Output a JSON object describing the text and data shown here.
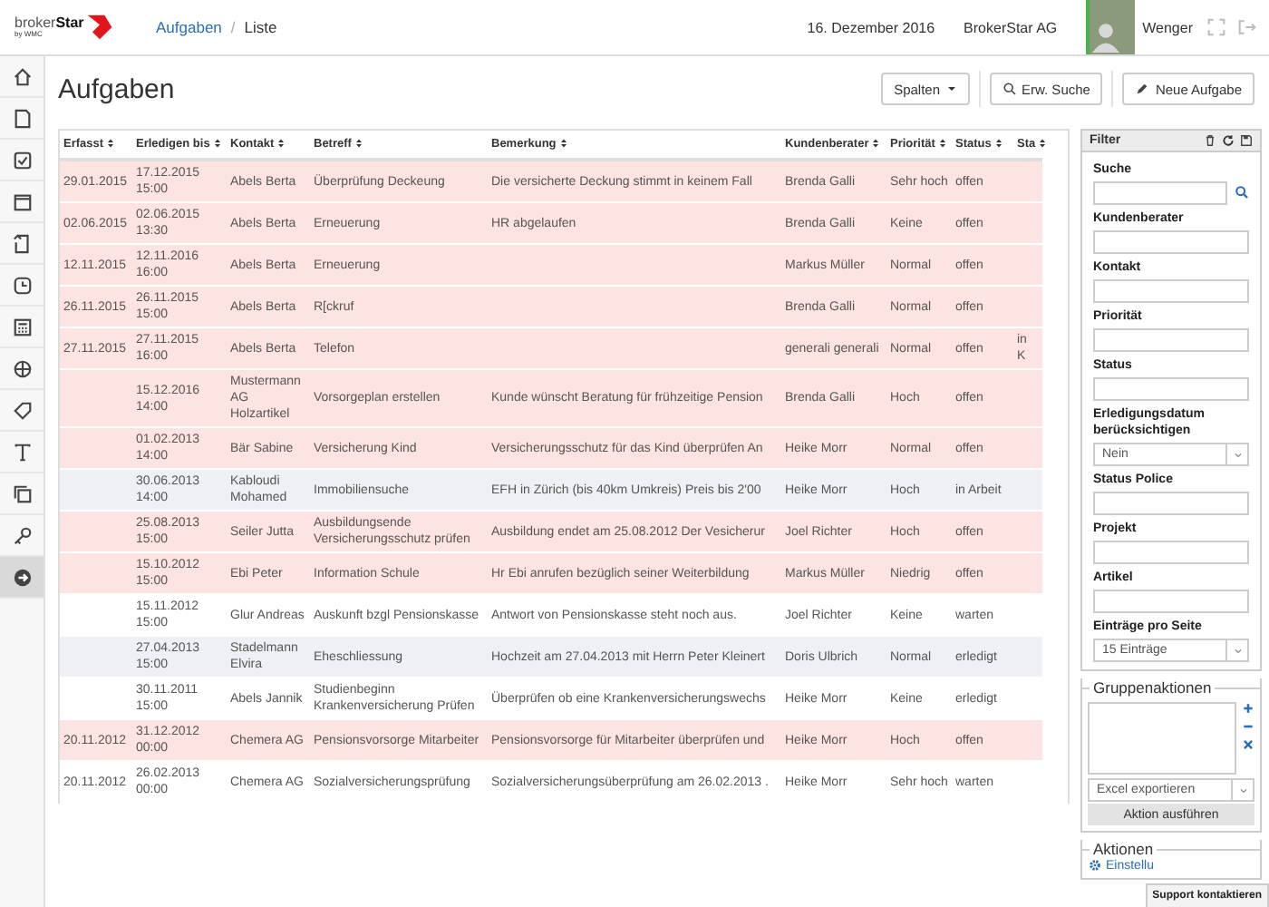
{
  "header": {
    "logo": {
      "word": "broker",
      "accent": "Star",
      "tagline": "by WMC"
    },
    "breadcrumb": {
      "items": [
        "Aufgaben",
        "Liste"
      ],
      "separator": "/"
    },
    "date": "16. Dezember 2016",
    "company": "BrokerStar AG",
    "user": "Wenger"
  },
  "sidebar": {
    "items": [
      {
        "selected": false
      },
      {
        "selected": false
      },
      {
        "selected": false
      },
      {
        "selected": false
      },
      {
        "selected": false
      },
      {
        "selected": false
      },
      {
        "selected": false
      },
      {
        "selected": false
      },
      {
        "selected": false
      },
      {
        "selected": false
      },
      {
        "selected": false
      },
      {
        "selected": false
      },
      {
        "selected": true
      }
    ]
  },
  "page": {
    "title": "Aufgaben",
    "buttons": [
      {
        "kind": "dropdown",
        "label": "Spalten"
      },
      {
        "kind": "search",
        "label": "Erw. Suche"
      },
      {
        "kind": "create",
        "label": "Neue Aufgabe"
      }
    ]
  },
  "table": {
    "columns": [
      "Erfasst",
      "Erledigen bis",
      "Kontakt",
      "Betreff",
      "Bemerkung",
      "Kundenberater",
      "Priorität",
      "Status",
      "Sta"
    ],
    "rows": [
      {
        "kind": "alert",
        "cells": [
          "29.01.2015",
          "17.12.2015 15:00",
          "Abels Berta",
          "Überprüfung Deckeung",
          "Die versicherte Deckung stimmt in keinem Fall",
          "Brenda Galli",
          "Sehr hoch",
          "offen",
          null
        ]
      },
      {
        "kind": "alert",
        "cells": [
          "02.06.2015",
          "02.06.2015 13:30",
          "Abels Berta",
          "Erneuerung",
          "HR abgelaufen",
          "Brenda Galli",
          "Keine",
          "offen",
          null
        ]
      },
      {
        "kind": "alert",
        "cells": [
          "12.11.2015",
          "12.11.2016 16:00",
          "Abels Berta",
          "Erneuerung",
          null,
          "Markus Müller",
          "Normal",
          "offen",
          null
        ]
      },
      {
        "kind": "alert",
        "cells": [
          "26.11.2015",
          "26.11.2015 15:00",
          "Abels Berta",
          "R[ckruf",
          null,
          "Brenda Galli",
          "Normal",
          "offen",
          null
        ]
      },
      {
        "kind": "alert",
        "cells": [
          "27.11.2015",
          "27.11.2015 16:00",
          "Abels Berta",
          "Telefon",
          null,
          "generali generali",
          "Normal",
          "offen",
          "in K"
        ]
      },
      {
        "kind": "alert",
        "cells": [
          null,
          "15.12.2016 14:00",
          "Mustermann AG Holzartikel",
          "Vorsorgeplan erstellen",
          "Kunde wünscht Beratung für frühzeitige Pension",
          "Brenda Galli",
          "Hoch",
          "offen",
          null
        ]
      },
      {
        "kind": "alert",
        "cells": [
          null,
          "01.02.2013 14:00",
          "Bär Sabine",
          "Versicherung Kind",
          "Versicherungsschutz für das Kind überprüfen An",
          "Heike Morr",
          "Normal",
          "offen",
          null
        ]
      },
      {
        "kind": "muted",
        "cells": [
          null,
          "30.06.2013 14:00",
          "Kabloudi Mohamed",
          "Immobiliensuche",
          "EFH in Zürich (bis 40km Umkreis) Preis bis 2'00",
          "Heike Morr",
          "Hoch",
          "in Arbeit",
          null
        ]
      },
      {
        "kind": "alert",
        "cells": [
          null,
          "25.08.2013 15:00",
          "Seiler Jutta",
          "Ausbildungsende Versicherungsschutz prüfen",
          "Ausbildung endet am 25.08.2012 Der Vesicherur",
          "Joel Richter",
          "Hoch",
          "offen",
          null
        ]
      },
      {
        "kind": "alert",
        "cells": [
          null,
          "15.10.2012 15:00",
          "Ebi Peter",
          "Information Schule",
          "Hr Ebi anrufen bezüglich seiner Weiterbildung",
          "Markus Müller",
          "Niedrig",
          "offen",
          null
        ]
      },
      {
        "kind": "plain",
        "cells": [
          null,
          "15.11.2012 15:00",
          "Glur Andreas",
          "Auskunft bzgl Pensionskasse",
          "Antwort von Pensionskasse steht noch aus.",
          "Joel Richter",
          "Keine",
          "warten",
          null
        ]
      },
      {
        "kind": "muted",
        "cells": [
          null,
          "27.04.2013 15:00",
          "Stadelmann Elvira",
          "Eheschliessung",
          "Hochzeit am 27.04.2013 mit Herrn Peter Kleinert",
          "Doris Ulbrich",
          "Normal",
          "erledigt",
          null
        ]
      },
      {
        "kind": "plain",
        "cells": [
          null,
          "30.11.2011 15:00",
          "Abels Jannik",
          "Studienbeginn Krankenversicherung Prüfen",
          "Überprüfen ob eine Krankenversicherungswechs",
          "Heike Morr",
          "Keine",
          "erledigt",
          null
        ]
      },
      {
        "kind": "alert",
        "cells": [
          "20.11.2012",
          "31.12.2012 00:00",
          "Chemera AG",
          "Pensionsvorsorge Mitarbeiter",
          "Pensionsvorsorge für Mitarbeiter überprüfen und",
          "Heike Morr",
          "Hoch",
          "offen",
          null
        ]
      },
      {
        "kind": "plain",
        "cells": [
          "20.11.2012",
          "26.02.2013 00:00",
          "Chemera AG",
          "Sozialversicherungsprüfung",
          "Sozialversicherungsüberprüfung am 26.02.2013 .",
          "Heike Morr",
          "Sehr hoch",
          "warten",
          null
        ]
      }
    ]
  },
  "filter": {
    "title": "Filter",
    "fields": [
      {
        "kind": "search",
        "label": "Suche"
      },
      {
        "kind": "text",
        "label": "Kundenberater"
      },
      {
        "kind": "text",
        "label": "Kontakt"
      },
      {
        "kind": "text",
        "label": "Priorität"
      },
      {
        "kind": "text",
        "label": "Status"
      },
      {
        "kind": "select",
        "label": "Erledigungsdatum berücksichtigen",
        "value": "Nein"
      },
      {
        "kind": "text",
        "label": "Status Police"
      },
      {
        "kind": "text",
        "label": "Projekt"
      },
      {
        "kind": "text",
        "label": "Artikel"
      },
      {
        "kind": "select",
        "label": "Einträge pro Seite",
        "value": "15 Einträge"
      }
    ]
  },
  "group_actions": {
    "title": "Gruppenaktionen",
    "action": "Excel exportieren",
    "run_button": "Aktion ausführen"
  },
  "actions": {
    "title": "Aktionen",
    "links": [
      "Einstellu"
    ]
  },
  "support_button": "Support kontaktieren"
}
